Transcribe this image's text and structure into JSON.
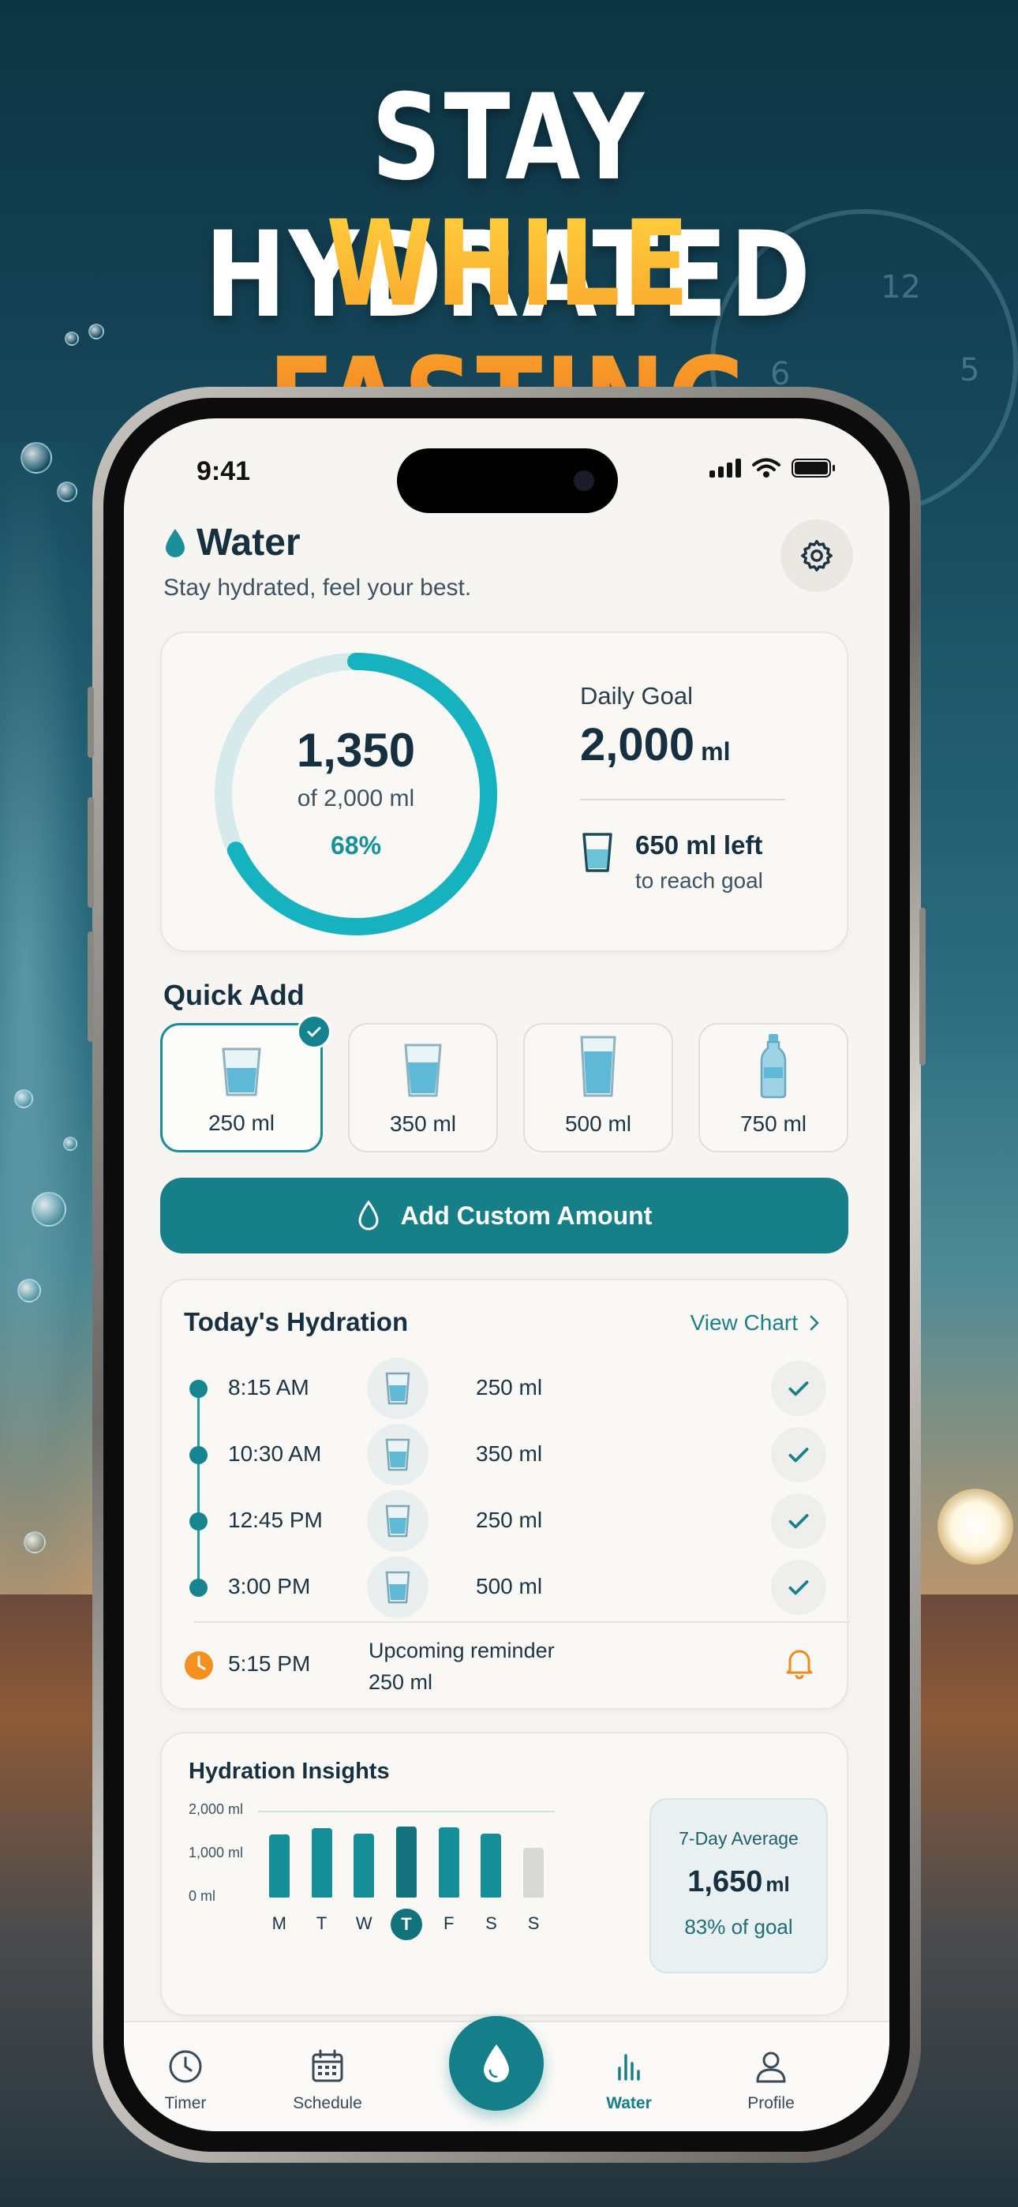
{
  "promo": {
    "headline_line1": "STAY HYDRATED",
    "headline_line2": "WHILE FASTING"
  },
  "status_bar": {
    "time": "9:41"
  },
  "header": {
    "title": "Water",
    "subtitle": "Stay hydrated, feel your best."
  },
  "progress": {
    "consumed": "1,350",
    "of_goal": "of 2,000 ml",
    "percent_text": "68%",
    "percent": 0.68,
    "accent_color": "#17b2c0",
    "track_color": "#d6eaec"
  },
  "goal": {
    "label": "Daily Goal",
    "value": "2,000",
    "unit": "ml",
    "left_value": "650 ml left",
    "left_sub": "to reach goal"
  },
  "quick_add": {
    "title": "Quick Add",
    "options": [
      {
        "label": "250 ml",
        "icon": "small-glass-icon",
        "selected": true
      },
      {
        "label": "350 ml",
        "icon": "glass-icon",
        "selected": false
      },
      {
        "label": "500 ml",
        "icon": "tall-glass-icon",
        "selected": false
      },
      {
        "label": "750 ml",
        "icon": "bottle-icon",
        "selected": false
      }
    ],
    "custom_button": "Add Custom Amount"
  },
  "hydration": {
    "title": "Today's Hydration",
    "view_chart": "View Chart",
    "entries": [
      {
        "time": "8:15 AM",
        "amount": "250 ml"
      },
      {
        "time": "10:30 AM",
        "amount": "350 ml"
      },
      {
        "time": "12:45 PM",
        "amount": "250 ml"
      },
      {
        "time": "3:00 PM",
        "amount": "500 ml"
      }
    ],
    "reminder": {
      "time": "5:15 PM",
      "title": "Upcoming reminder",
      "amount": "250 ml"
    }
  },
  "insights": {
    "title": "Hydration Insights",
    "average_label": "7-Day Average",
    "average_value": "1,650",
    "average_unit": "ml",
    "average_pct": "83% of goal"
  },
  "chart_data": {
    "type": "bar",
    "title": "Hydration Insights",
    "categories": [
      "M",
      "T",
      "W",
      "T",
      "F",
      "S",
      "S"
    ],
    "values": [
      1450,
      1600,
      1480,
      1640,
      1620,
      1470,
      1150
    ],
    "ytick_labels": [
      "2,000 ml",
      "1,000 ml",
      "0 ml"
    ],
    "ylim": [
      0,
      2000
    ],
    "goal_line": 2000,
    "highlight_index": 3,
    "future_index": 6,
    "bar_color": "#168e98",
    "future_color": "#d8d8d6"
  },
  "tabbar": {
    "tabs": [
      {
        "label": "Timer",
        "icon": "timer-icon"
      },
      {
        "label": "Schedule",
        "icon": "calendar-icon"
      },
      {
        "label": "Water",
        "icon": "bar-chart-icon",
        "active": true
      },
      {
        "label": "Profile",
        "icon": "user-icon"
      }
    ],
    "center_icon": "water-drop-icon"
  }
}
